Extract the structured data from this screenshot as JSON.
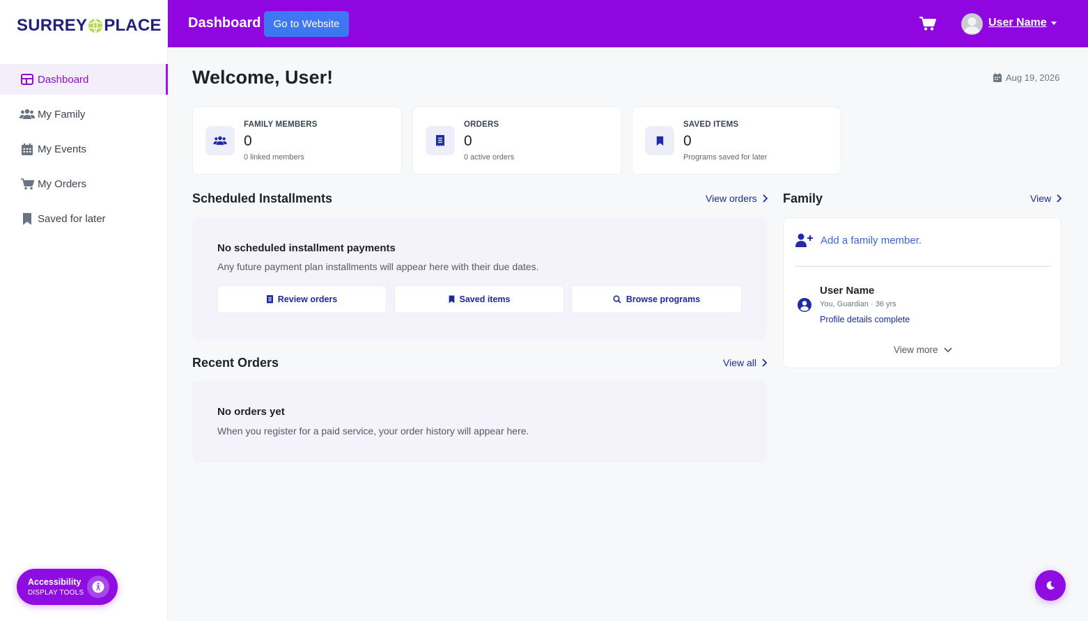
{
  "brand": {
    "logo_left": "SURREY",
    "logo_right": "PLACE",
    "brand_color": "#22207a",
    "accent": "#9006e0"
  },
  "sidebar": {
    "items": [
      {
        "label": "Dashboard",
        "icon": "dashboard-grid-icon",
        "active": true
      },
      {
        "label": "My Family",
        "icon": "users-icon"
      },
      {
        "label": "My Events",
        "icon": "calendar-icon"
      },
      {
        "label": "My Orders",
        "icon": "cart-icon"
      },
      {
        "label": "Saved for later",
        "icon": "bookmark-icon"
      }
    ],
    "accessibility": {
      "title": "Accessibility",
      "subtitle": "DISPLAY TOOLS"
    }
  },
  "header": {
    "title": "Dashboard",
    "website_button": "Go to Website",
    "user_name": "User Name"
  },
  "main": {
    "welcome": "Welcome, User!",
    "date": "Aug 19, 2026",
    "stats": [
      {
        "label": "FAMILY MEMBERS",
        "value": "0",
        "sub": "0 linked members",
        "icon": "users-icon"
      },
      {
        "label": "ORDERS",
        "value": "0",
        "sub": "0 active orders",
        "icon": "receipt-icon"
      },
      {
        "label": "SAVED ITEMS",
        "value": "0",
        "sub": "Programs saved for later",
        "icon": "bookmark-icon"
      }
    ],
    "installments": {
      "title": "Scheduled Installments",
      "link": "View orders",
      "empty_title": "No scheduled installment payments",
      "empty_desc": "Any future payment plan installments will appear here with their due dates.",
      "buttons": [
        "Review orders",
        "Saved items",
        "Browse programs"
      ]
    },
    "orders": {
      "title": "Recent Orders",
      "link": "View all",
      "empty_title": "No orders yet",
      "empty_desc": "When you register for a paid service, your order history will appear here."
    },
    "family": {
      "title": "Family",
      "link": "View",
      "add_label": "Add a family member.",
      "member": {
        "name": "User Name",
        "role": "You, Guardian · 36 yrs",
        "status": "Profile details complete"
      },
      "view_more": "View more"
    }
  }
}
